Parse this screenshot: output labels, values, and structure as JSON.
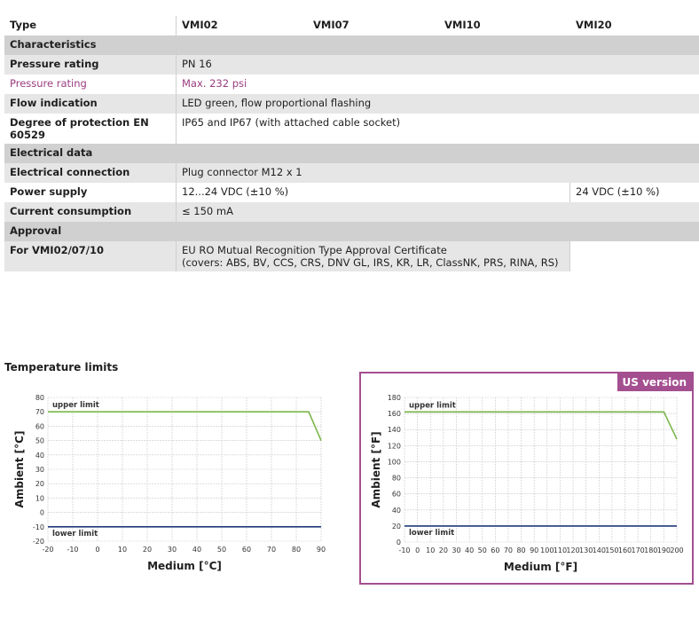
{
  "table": {
    "header": {
      "type": "Type",
      "models": [
        "VMI02",
        "VMI07",
        "VMI10",
        "VMI20"
      ]
    },
    "sections": {
      "characteristics": "Characteristics",
      "electrical": "Electrical data",
      "approval": "Approval"
    },
    "rows": {
      "pressure_rating": {
        "label": "Pressure rating",
        "value": "PN 16"
      },
      "pressure_rating_psi": {
        "label": "Pressure rating",
        "value": "Max. 232 psi"
      },
      "flow_indication": {
        "label": "Flow indication",
        "value": "LED green, flow proportional flashing"
      },
      "degree_protection": {
        "label": "Degree of protection EN 60529",
        "value": "IP65 and IP67 (with attached cable socket)"
      },
      "electrical_connection": {
        "label": "Electrical connection",
        "value": "Plug connector M12 x 1"
      },
      "power_supply": {
        "label": "Power supply",
        "value": "12...24 VDC (±10 %)",
        "value_vmi20": "24 VDC (±10 %)"
      },
      "current_consumption": {
        "label": "Current consumption",
        "value": "≤ 150 mA"
      },
      "approval_vmi": {
        "label": "For VMI02/07/10",
        "value_line1": "EU RO Mutual Recognition Type Approval Certificate",
        "value_line2": "(covers: ABS, BV, CCS, CRS, DNV GL, IRS, KR, LR, ClassNK, PRS, RINA, RS)"
      }
    }
  },
  "temperature_title": "Temperature limits",
  "us_badge": "US version",
  "chart_data": [
    {
      "type": "line",
      "xlabel": "Medium [°C]",
      "ylabel": "Ambient [°C]",
      "xlim": [
        -20,
        90
      ],
      "ylim": [
        -20,
        80
      ],
      "xticks": [
        -20,
        -10,
        0,
        10,
        20,
        30,
        40,
        50,
        60,
        70,
        80,
        90
      ],
      "yticks": [
        -20,
        -10,
        0,
        10,
        20,
        30,
        40,
        50,
        60,
        70,
        80
      ],
      "grid": true,
      "series": [
        {
          "name": "upper limit",
          "color": "#7ab648",
          "x": [
            -20,
            85,
            90
          ],
          "y": [
            70,
            70,
            50
          ]
        },
        {
          "name": "lower limit",
          "color": "#1f3a7a",
          "x": [
            -20,
            90
          ],
          "y": [
            -10,
            -10
          ]
        }
      ]
    },
    {
      "type": "line",
      "xlabel": "Medium [°F]",
      "ylabel": "Ambient [°F]",
      "xlim": [
        -10,
        200
      ],
      "ylim": [
        0,
        180
      ],
      "xticks": [
        -10,
        0,
        10,
        20,
        30,
        40,
        50,
        60,
        70,
        80,
        90,
        100,
        110,
        120,
        130,
        140,
        150,
        160,
        170,
        180,
        190,
        200
      ],
      "yticks": [
        0,
        20,
        40,
        60,
        80,
        100,
        120,
        140,
        160,
        180
      ],
      "grid": true,
      "series": [
        {
          "name": "upper limit",
          "color": "#7ab648",
          "x": [
            -10,
            190,
            200
          ],
          "y": [
            162,
            162,
            128
          ]
        },
        {
          "name": "lower limit",
          "color": "#1f3a7a",
          "x": [
            -10,
            200
          ],
          "y": [
            20,
            20
          ]
        }
      ]
    }
  ]
}
